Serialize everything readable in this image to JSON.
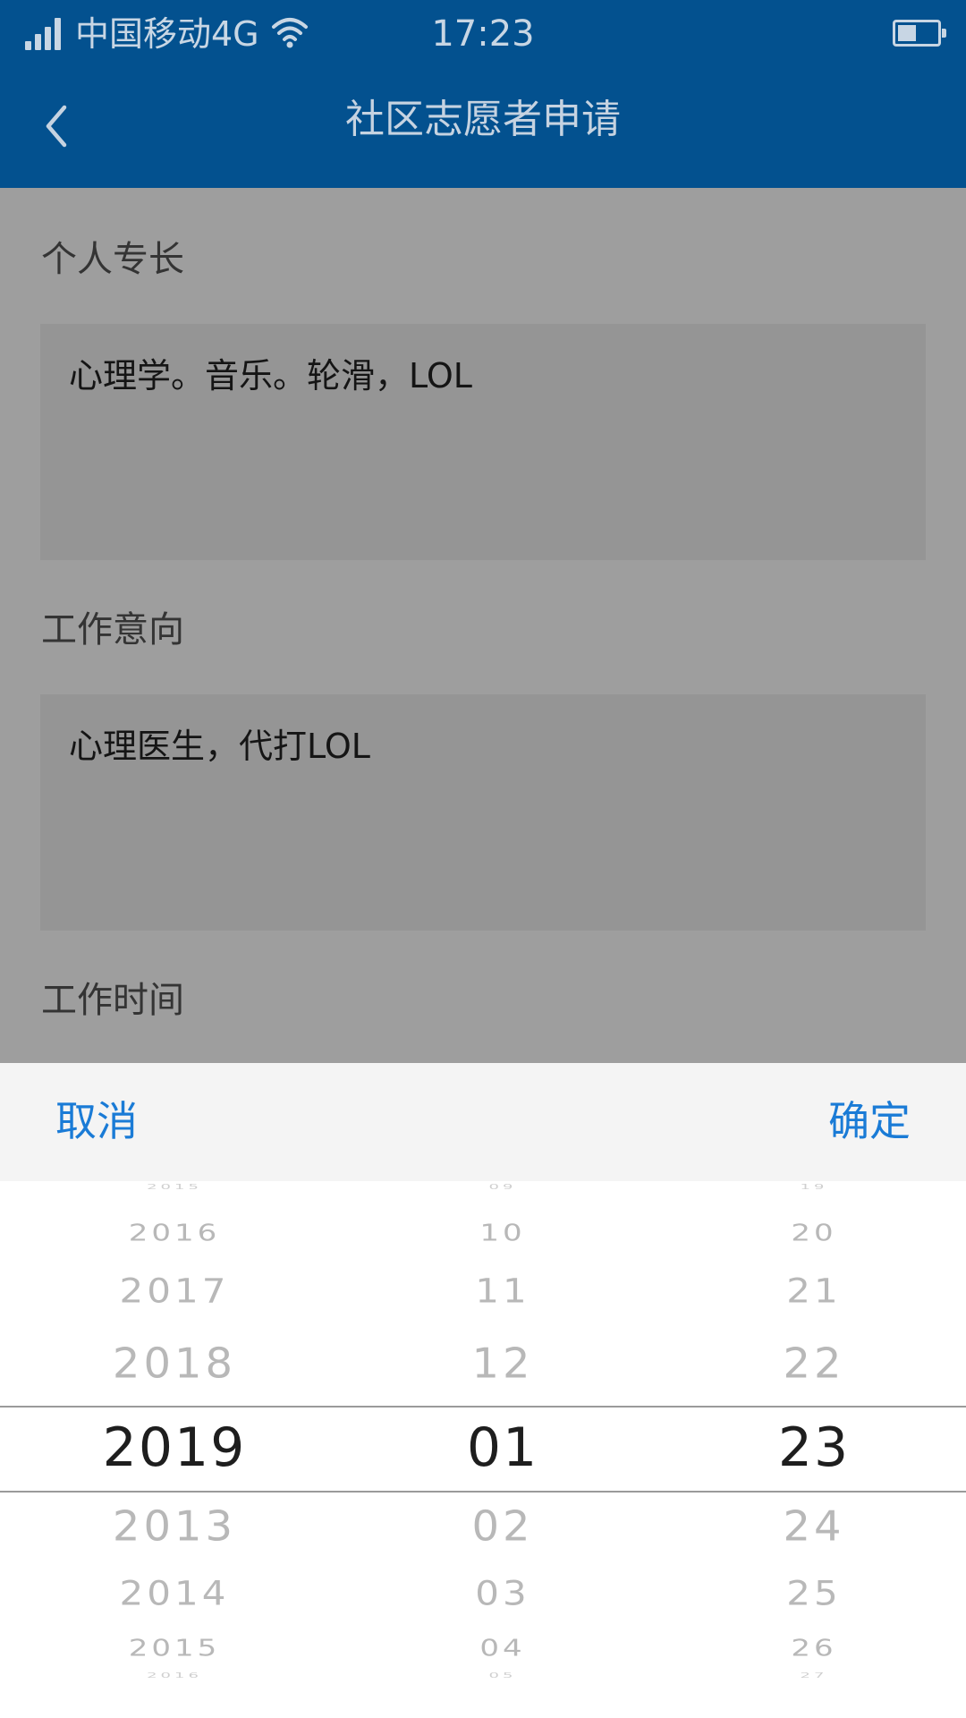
{
  "status_bar": {
    "carrier": "中国移动4G",
    "time": "17:23",
    "icons": [
      "signal-icon",
      "wifi-icon",
      "battery-icon"
    ]
  },
  "nav": {
    "title": "社区志愿者申请",
    "back_icon": "chevron-left-icon"
  },
  "form": {
    "specialty_label": "个人专长",
    "specialty_value": "心理学。音乐。轮滑，LOL",
    "intent_label": "工作意向",
    "intent_value": "心理医生，代打LOL",
    "worktime_label": "工作时间"
  },
  "picker": {
    "cancel_label": "取消",
    "confirm_label": "确定",
    "years": [
      "2015",
      "2016",
      "2017",
      "2018",
      "2019",
      "2013",
      "2014",
      "2015",
      "2016"
    ],
    "months": [
      "09",
      "10",
      "11",
      "12",
      "01",
      "02",
      "03",
      "04",
      "05"
    ],
    "days": [
      "19",
      "20",
      "21",
      "22",
      "23",
      "24",
      "25",
      "26",
      "27"
    ],
    "selected": {
      "year": "2019",
      "month": "01",
      "day": "23"
    }
  },
  "colors": {
    "header_bg": "#03518f",
    "accent": "#1a7bd6"
  }
}
